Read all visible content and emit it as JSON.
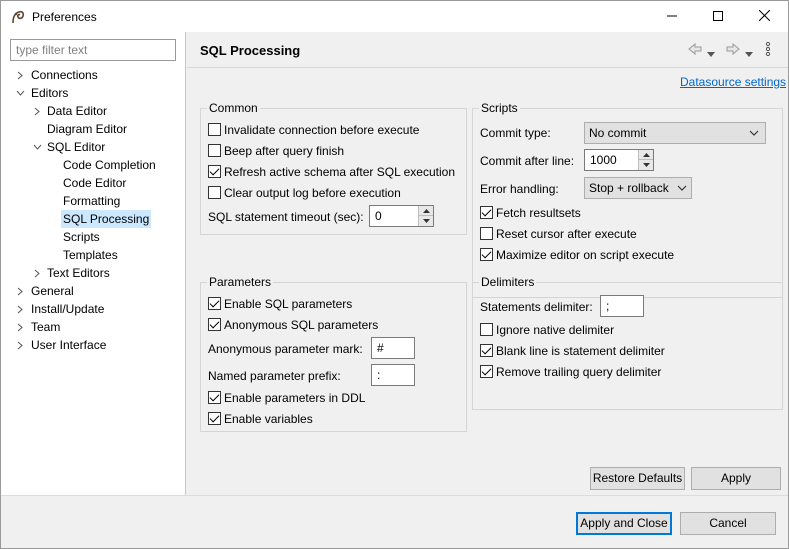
{
  "window": {
    "title": "Preferences"
  },
  "filter": {
    "placeholder": "type filter text"
  },
  "tree": [
    {
      "label": "Connections",
      "toggle": "collapsed",
      "selected": false
    },
    {
      "label": "Editors",
      "toggle": "expanded",
      "selected": false
    },
    {
      "label": "Data Editor",
      "toggle": "collapsed",
      "selected": false
    },
    {
      "label": "Diagram Editor",
      "toggle": "none",
      "selected": false
    },
    {
      "label": "SQL Editor",
      "toggle": "expanded",
      "selected": false
    },
    {
      "label": "Code Completion",
      "toggle": "none",
      "selected": false
    },
    {
      "label": "Code Editor",
      "toggle": "none",
      "selected": false
    },
    {
      "label": "Formatting",
      "toggle": "none",
      "selected": false
    },
    {
      "label": "SQL Processing",
      "toggle": "none",
      "selected": true
    },
    {
      "label": "Scripts",
      "toggle": "none",
      "selected": false
    },
    {
      "label": "Templates",
      "toggle": "none",
      "selected": false
    },
    {
      "label": "Text Editors",
      "toggle": "collapsed",
      "selected": false
    },
    {
      "label": "General",
      "toggle": "collapsed",
      "selected": false
    },
    {
      "label": "Install/Update",
      "toggle": "collapsed",
      "selected": false
    },
    {
      "label": "Team",
      "toggle": "collapsed",
      "selected": false
    },
    {
      "label": "User Interface",
      "toggle": "collapsed",
      "selected": false
    }
  ],
  "page": {
    "title": "SQL Processing",
    "datasource_link": "Datasource settings"
  },
  "common": {
    "title": "Common",
    "invalidate": {
      "label": "Invalidate connection before execute",
      "checked": false
    },
    "beep": {
      "label": "Beep after query finish",
      "checked": false
    },
    "refresh_schema": {
      "label": "Refresh active schema after SQL execution",
      "checked": true
    },
    "clear_log": {
      "label": "Clear output log before execution",
      "checked": false
    },
    "timeout_label": "SQL statement timeout (sec):",
    "timeout_value": "0"
  },
  "scripts": {
    "title": "Scripts",
    "commit_type_label": "Commit type:",
    "commit_type_value": "No commit",
    "commit_after_label": "Commit after line:",
    "commit_after_value": "1000",
    "error_handling_label": "Error handling:",
    "error_handling_value": "Stop + rollback",
    "fetch_resultsets": {
      "label": "Fetch resultsets",
      "checked": true
    },
    "reset_cursor": {
      "label": "Reset cursor after execute",
      "checked": false
    },
    "maximize_editor": {
      "label": "Maximize editor on script execute",
      "checked": true
    }
  },
  "parameters": {
    "title": "Parameters",
    "enable_sql_params": {
      "label": "Enable SQL parameters",
      "checked": true
    },
    "anonymous_params": {
      "label": "Anonymous SQL parameters",
      "checked": true
    },
    "anon_mark_label": "Anonymous parameter mark:",
    "anon_mark_value": "#",
    "named_prefix_label": "Named parameter prefix:",
    "named_prefix_value": ":",
    "enable_ddl": {
      "label": "Enable parameters in DDL",
      "checked": true
    },
    "enable_variables": {
      "label": "Enable variables",
      "checked": true
    }
  },
  "delimiters": {
    "title": "Delimiters",
    "statements_delimiter_label": "Statements delimiter:",
    "statements_delimiter_value": ";",
    "ignore_native": {
      "label": "Ignore native delimiter",
      "checked": false
    },
    "blank_line": {
      "label": "Blank line is statement delimiter",
      "checked": true
    },
    "remove_trailing": {
      "label": "Remove trailing query delimiter",
      "checked": true
    }
  },
  "buttons": {
    "restore_defaults": "Restore Defaults",
    "apply": "Apply",
    "apply_and_close": "Apply and Close",
    "cancel": "Cancel"
  },
  "colors": {
    "selection": "#cce8ff",
    "link": "#0066cc",
    "default_button_border": "#0078d7"
  }
}
